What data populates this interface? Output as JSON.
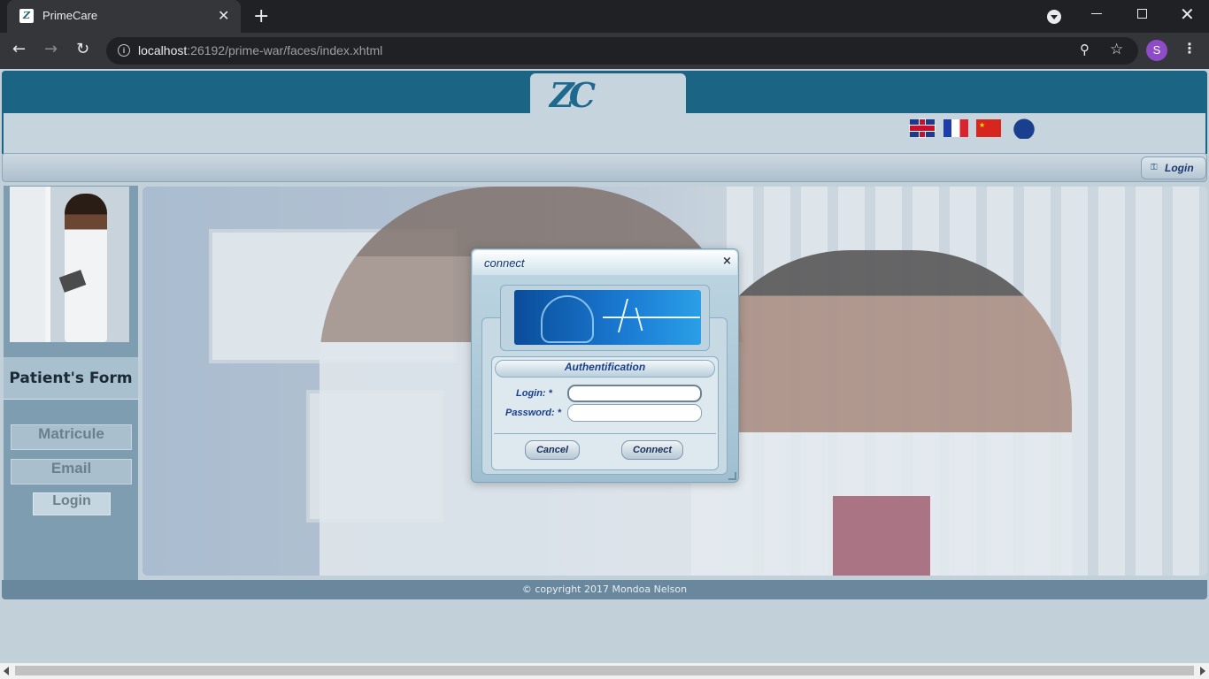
{
  "browser": {
    "tab_title": "PrimeCare",
    "tab_close": "✕",
    "new_tab": "+",
    "url_host": "localhost",
    "url_path": ":26192/prime-war/faces/index.xhtml",
    "profile_initial": "S",
    "icons": [
      "back-arrow-icon",
      "forward-arrow-icon",
      "reload-icon",
      "info-icon",
      "zoom-icon",
      "star-icon",
      "menu-icon",
      "tab-search-icon"
    ]
  },
  "header": {
    "logo_text": "ZC",
    "languages": [
      "english-flag",
      "french-flag",
      "chinese-flag",
      "other-flag"
    ]
  },
  "navbar": {
    "login_label": "Login"
  },
  "sidebar": {
    "form_title": "Patient's Form",
    "matricule_label": "Matricule",
    "email_label": "Email",
    "login_label": "Login"
  },
  "footer": {
    "text": "© copyright 2017 Mondoa Nelson"
  },
  "dialog": {
    "title": "connect",
    "close": "×",
    "panel_title": "Authentification",
    "login_label": "Login:",
    "password_label": "Password:",
    "required_mark": "*",
    "login_value": "",
    "password_value": "",
    "cancel_label": "Cancel",
    "connect_label": "Connect"
  },
  "colors": {
    "header_blue": "#1b6484",
    "page_bg": "#c2d0da",
    "label_blue": "#1b3f8a"
  }
}
